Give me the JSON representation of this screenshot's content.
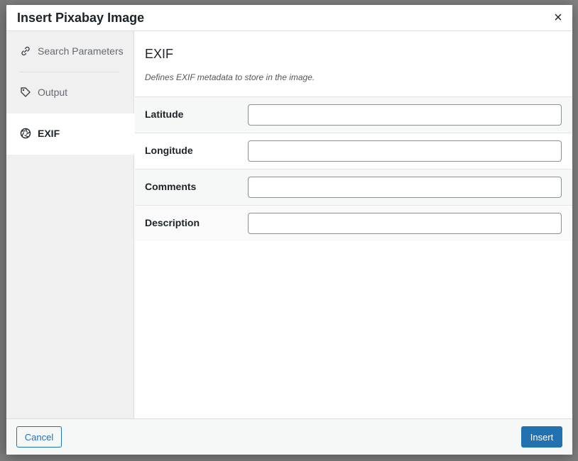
{
  "modal": {
    "title": "Insert Pixabay Image",
    "close_icon": "close-icon"
  },
  "sidebar": {
    "items": [
      {
        "label": "Search Parameters",
        "icon": "link-icon",
        "active": false
      },
      {
        "label": "Output",
        "icon": "tag-icon",
        "active": false
      },
      {
        "label": "EXIF",
        "icon": "aperture-icon",
        "active": true
      }
    ]
  },
  "section": {
    "title": "EXIF",
    "description": "Defines EXIF metadata to store in the image."
  },
  "fields": [
    {
      "label": "Latitude",
      "value": ""
    },
    {
      "label": "Longitude",
      "value": ""
    },
    {
      "label": "Comments",
      "value": ""
    },
    {
      "label": "Description",
      "value": ""
    }
  ],
  "footer": {
    "cancel_label": "Cancel",
    "insert_label": "Insert"
  },
  "colors": {
    "accent": "#2271b1",
    "sidebar_bg": "#f0f0f1",
    "text": "#1d2327"
  }
}
